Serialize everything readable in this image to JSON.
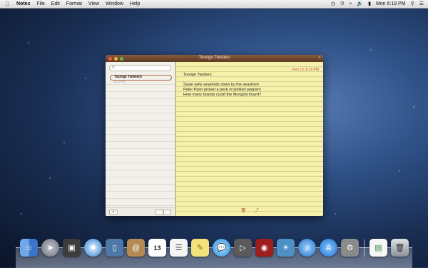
{
  "menubar": {
    "app_name": "Notes",
    "items": [
      "File",
      "Edit",
      "Format",
      "View",
      "Window",
      "Help"
    ],
    "clock": "Mon 6:19 PM"
  },
  "window": {
    "title": "Tounge Twisters",
    "search_placeholder": "",
    "notes": [
      {
        "title": "Tounge Twisters",
        "time": "6:19 PM"
      }
    ],
    "editor": {
      "date": "Feb 13, 6:19 PM",
      "title": "Tounge Twisters",
      "lines": [
        "Susie sells seashells down by the seashore",
        "Peter Piper picked a peck of pickled peppers",
        "How many boards could the Mongols hoard?"
      ]
    },
    "add_label": "+"
  },
  "dock": {
    "items": [
      "finder",
      "launchpad",
      "dashboard",
      "safari",
      "preview",
      "address-book",
      "calendar",
      "reminders",
      "notes",
      "messages",
      "facetime",
      "photo-booth",
      "iphoto",
      "itunes",
      "app-store",
      "system-preferences",
      "document-stack",
      "trash"
    ],
    "calendar_day": "13"
  }
}
